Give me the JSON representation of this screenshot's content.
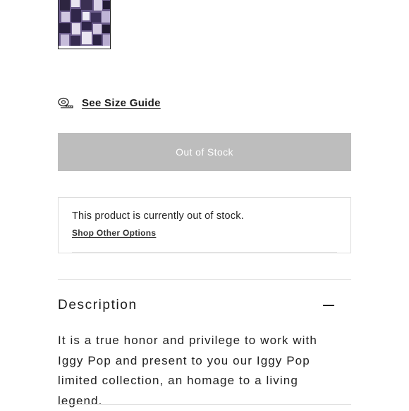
{
  "product_gallery": {
    "thumbnail_alt": "Iggy Pop collage print product thumbnail"
  },
  "size_guide": {
    "icon": "tape-measure-icon",
    "label": "See Size Guide"
  },
  "purchase": {
    "button_label": "Out of Stock",
    "button_color": "#bdbdbd"
  },
  "stock_notice": {
    "message": "This product is currently out of stock.",
    "link_label": "Shop Other Options"
  },
  "description": {
    "title": "Description",
    "toggle_icon": "minus-icon",
    "body": "It is a true honor and privilege to work with Iggy Pop and present to you our Iggy Pop limited collection, an homage to a living legend."
  }
}
